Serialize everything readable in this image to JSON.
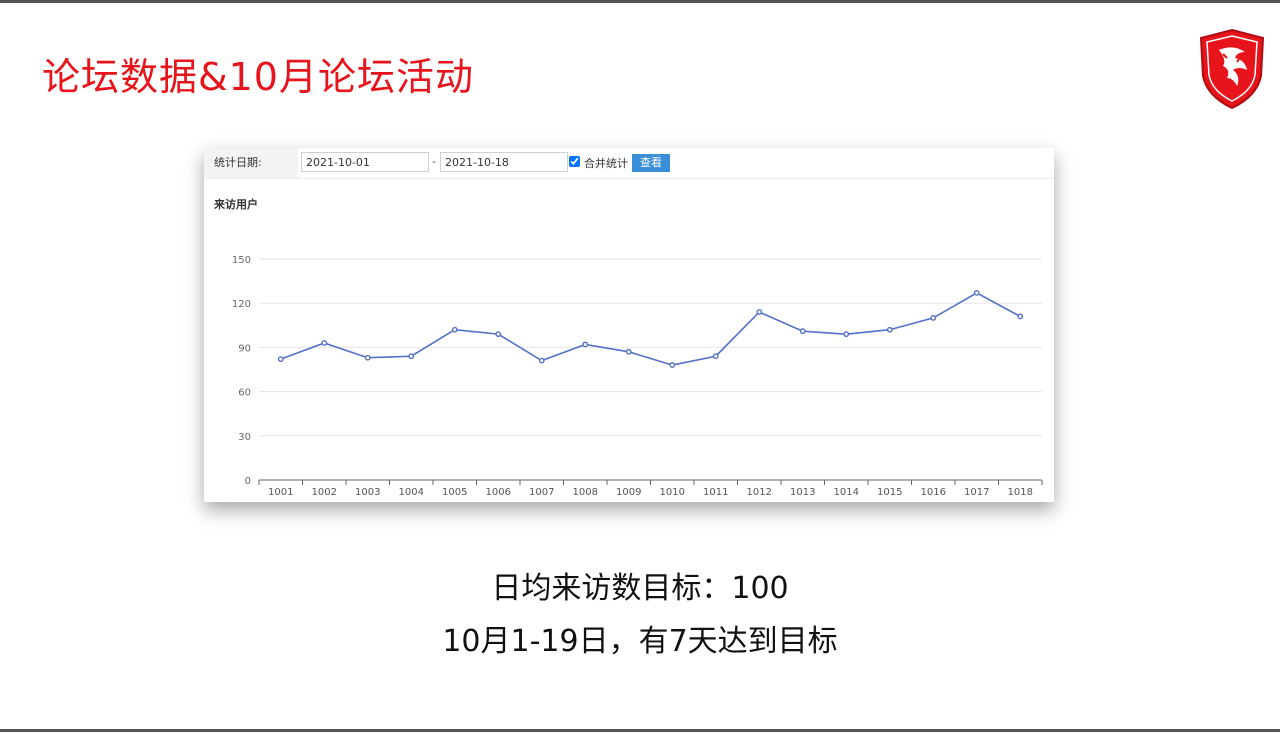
{
  "slide": {
    "title": "论坛数据&10月论坛活动",
    "summary_line1": "日均来访数目标：100",
    "summary_line2": "10月1-19日，有7天达到目标"
  },
  "filter": {
    "label": "统计日期:",
    "start_date": "2021-10-01",
    "separator": "-",
    "end_date": "2021-10-18",
    "merge_label": "合并统计",
    "merge_checked": true,
    "view_button": "查看"
  },
  "colors": {
    "title": "#e8141b",
    "line": "#5470c6",
    "button": "#3a8fd8"
  },
  "chart_data": {
    "type": "line",
    "title": "来访用户",
    "categories": [
      "1001",
      "1002",
      "1003",
      "1004",
      "1005",
      "1006",
      "1007",
      "1008",
      "1009",
      "1010",
      "1011",
      "1012",
      "1013",
      "1014",
      "1015",
      "1016",
      "1017",
      "1018"
    ],
    "series": [
      {
        "values": [
          82,
          93,
          83,
          84,
          102,
          99,
          81,
          92,
          87,
          78,
          84,
          114,
          101,
          99,
          102,
          110,
          127,
          111
        ]
      }
    ],
    "yticks": [
      0,
      30,
      60,
      90,
      120,
      150
    ],
    "ylim": [
      0,
      150
    ],
    "grid": true,
    "legend": "none"
  }
}
